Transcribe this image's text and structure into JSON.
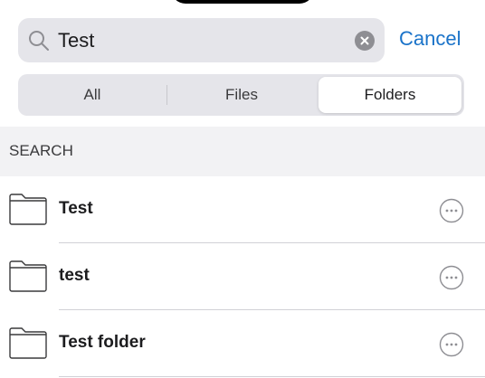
{
  "search": {
    "value": "Test",
    "cancel_label": "Cancel"
  },
  "segmented": {
    "options": [
      "All",
      "Files",
      "Folders"
    ],
    "selected": "Folders"
  },
  "section": {
    "title": "SEARCH"
  },
  "results": [
    {
      "name": "Test",
      "icon": "folder-icon"
    },
    {
      "name": "test",
      "icon": "folder-icon"
    },
    {
      "name": "Test folder",
      "icon": "folder-icon"
    }
  ],
  "colors": {
    "accent": "#1a73c9",
    "field_bg": "#e5e5ea",
    "section_bg": "#f2f2f4"
  }
}
